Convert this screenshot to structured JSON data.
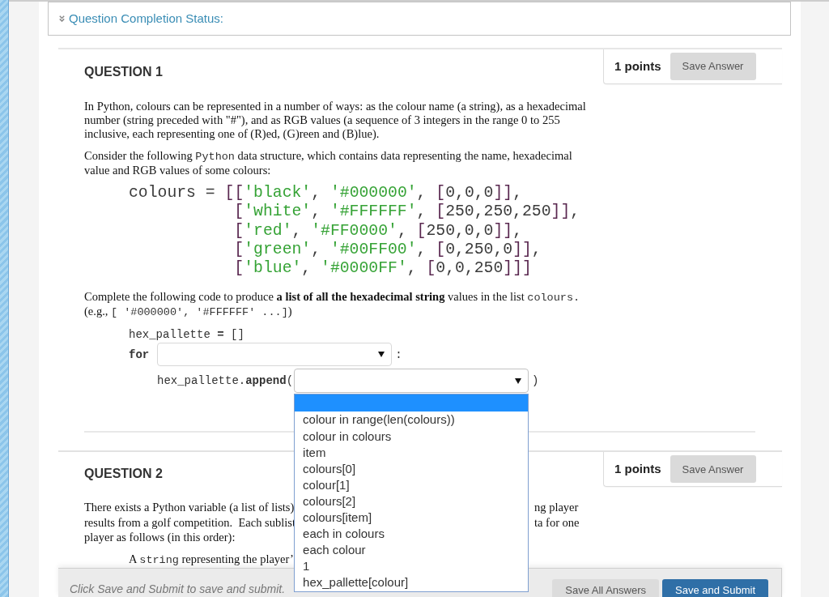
{
  "completion_status": {
    "label": "Question Completion Status:",
    "expanded": false
  },
  "question_1": {
    "title": "QUESTION 1",
    "points": "1 points",
    "save_button": "Save Answer",
    "intro": [
      [
        {
          "text": "In Python, colours can be represented in a number of ways: as the colour name (a string), as a hexadecimal number (string preceded with \"#\"), and as RGB values (a sequence of 3 integers in the range 0 to 255 inclusive, each representing one of (R)ed, (G)reen and (B)lue).",
          "kind": "prose"
        }
      ],
      [
        {
          "text": "Consider the following ",
          "kind": "prose"
        },
        {
          "text": "Python",
          "kind": "code"
        },
        {
          "text": " data structure, which contains data representing the name, hexadecimal value and RGB values of some colours:",
          "kind": "prose"
        }
      ]
    ],
    "code": {
      "head": [
        {
          "text": "colours = ",
          "kind": "plain"
        },
        {
          "text": "[",
          "kind": "bracket"
        }
      ],
      "lines": [
        {
          "tokens": [
            {
              "text": "[",
              "kind": "bracket"
            },
            {
              "text": "'black'",
              "kind": "string"
            },
            {
              "text": ", ",
              "kind": "plain"
            },
            {
              "text": "'#000000'",
              "kind": "string"
            },
            {
              "text": ", ",
              "kind": "plain"
            },
            {
              "text": "[",
              "kind": "bracket"
            },
            {
              "text": "0,0,0",
              "kind": "plain"
            },
            {
              "text": "]]",
              "kind": "bracket"
            },
            {
              "text": ",",
              "kind": "plain"
            }
          ]
        },
        {
          "tokens": [
            {
              "text": "[",
              "kind": "bracket"
            },
            {
              "text": "'white'",
              "kind": "string"
            },
            {
              "text": ", ",
              "kind": "plain"
            },
            {
              "text": "'#FFFFFF'",
              "kind": "string"
            },
            {
              "text": ", ",
              "kind": "plain"
            },
            {
              "text": "[",
              "kind": "bracket"
            },
            {
              "text": "250,250,250",
              "kind": "plain"
            },
            {
              "text": "]]",
              "kind": "bracket"
            },
            {
              "text": ",",
              "kind": "plain"
            }
          ]
        },
        {
          "tokens": [
            {
              "text": "[",
              "kind": "bracket"
            },
            {
              "text": "'red'",
              "kind": "string"
            },
            {
              "text": ", ",
              "kind": "plain"
            },
            {
              "text": "'#FF0000'",
              "kind": "string"
            },
            {
              "text": ", ",
              "kind": "plain"
            },
            {
              "text": "[",
              "kind": "bracket"
            },
            {
              "text": "250,0,0",
              "kind": "plain"
            },
            {
              "text": "]]",
              "kind": "bracket"
            },
            {
              "text": ",",
              "kind": "plain"
            }
          ]
        },
        {
          "tokens": [
            {
              "text": "[",
              "kind": "bracket"
            },
            {
              "text": "'green'",
              "kind": "string"
            },
            {
              "text": ", ",
              "kind": "plain"
            },
            {
              "text": "'#00FF00'",
              "kind": "string"
            },
            {
              "text": ", ",
              "kind": "plain"
            },
            {
              "text": "[",
              "kind": "bracket"
            },
            {
              "text": "0,250,0",
              "kind": "plain"
            },
            {
              "text": "]]",
              "kind": "bracket"
            },
            {
              "text": ",",
              "kind": "plain"
            }
          ]
        },
        {
          "tokens": [
            {
              "text": "[",
              "kind": "bracket"
            },
            {
              "text": "'blue'",
              "kind": "string"
            },
            {
              "text": ", ",
              "kind": "plain"
            },
            {
              "text": "'#0000FF'",
              "kind": "string"
            },
            {
              "text": ", ",
              "kind": "plain"
            },
            {
              "text": "[",
              "kind": "bracket"
            },
            {
              "text": "0,0,250",
              "kind": "plain"
            },
            {
              "text": "]]]",
              "kind": "bracket"
            }
          ]
        }
      ]
    },
    "task": [
      [
        {
          "text": "Complete the following code to produce **a list of all the hexadecimal string** values in the list ",
          "kind": "prose"
        },
        {
          "text": "colours.",
          "kind": "code"
        }
      ],
      [
        {
          "text": "(e.g., ",
          "kind": "prose"
        },
        {
          "text": "[ '#000000', '#FFFFFF' ...]",
          "kind": "code"
        },
        {
          "text": ")",
          "kind": "prose"
        }
      ]
    ],
    "answer": [
      {
        "kind": "text",
        "text": "hex_pallette **=** []"
      },
      {
        "kind": "blank",
        "before": "**for**",
        "select": {
          "expanded": false
        },
        "after": ":",
        "children": [
          {
            "kind": "blank",
            "before": "hex_pallette.**append**(",
            "after": ")",
            "select": {
              "expanded": true,
              "blank_highlighted": true,
              "options": [
                {
                  "label": "colour in range(len(colours))",
                  "selected": false
                },
                {
                  "label": "colour in colours",
                  "selected": false
                },
                {
                  "label": "item",
                  "selected": false
                },
                {
                  "label": "colours[0]",
                  "selected": false
                },
                {
                  "label": "colour[1]",
                  "selected": false
                },
                {
                  "label": "colours[2]",
                  "selected": false
                },
                {
                  "label": "colours[item]",
                  "selected": false
                },
                {
                  "label": "each in colours",
                  "selected": false
                },
                {
                  "label": "each colour",
                  "selected": false
                },
                {
                  "label": "1",
                  "selected": false
                },
                {
                  "label": "hex_pallette[colour]",
                  "selected": false
                }
              ]
            }
          }
        ]
      }
    ]
  },
  "question_2": {
    "title": "QUESTION 2",
    "points": "1 points",
    "save_button": "Save Answer",
    "lines": [
      {
        "left_part": "There exists a Python variable (a list of lists)",
        "right_part": "ng player"
      },
      {
        "left_part": "results from a golf competition.  Each sublist",
        "right_part": "ta for one"
      },
      {
        "left_part": "player as follows (in this order):"
      }
    ],
    "item": [
      {
        "text": "A ",
        "kind": "prose"
      },
      {
        "text": "string",
        "kind": "code"
      },
      {
        "text": " representing the player’",
        "kind": "prose"
      }
    ]
  },
  "footer": {
    "hint": "Click Save and Submit to save and submit.",
    "buttons": [
      {
        "label": "Save All Answers",
        "kind": "secondary"
      },
      {
        "label": "Save and Submit",
        "kind": "primary"
      }
    ]
  }
}
